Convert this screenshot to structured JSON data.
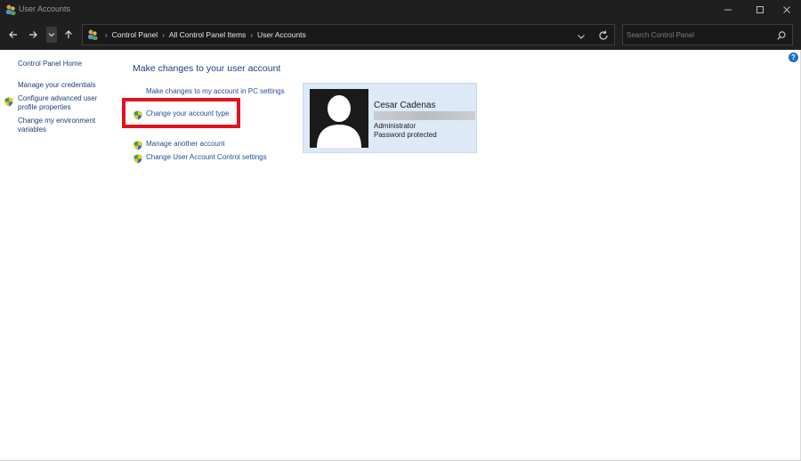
{
  "window": {
    "title": "User Accounts"
  },
  "nav": {
    "breadcrumbs": [
      "Control Panel",
      "All Control Panel Items",
      "User Accounts"
    ]
  },
  "search": {
    "placeholder": "Search Control Panel"
  },
  "help": {
    "label": "?"
  },
  "sidebar": {
    "home": "Control Panel Home",
    "items": [
      "Manage your credentials",
      "Configure advanced user profile properties",
      "Change my environment variables"
    ]
  },
  "main": {
    "heading": "Make changes to your user account",
    "tasks": [
      "Make changes to my account in PC settings",
      "Change your account type",
      "Manage another account",
      "Change User Account Control settings"
    ]
  },
  "account": {
    "name": "Cesar Cadenas",
    "role": "Administrator",
    "password_status": "Password protected"
  },
  "colors": {
    "highlight": "#e0131f",
    "link": "#1c4f94",
    "card_background": "#dde9f6"
  }
}
